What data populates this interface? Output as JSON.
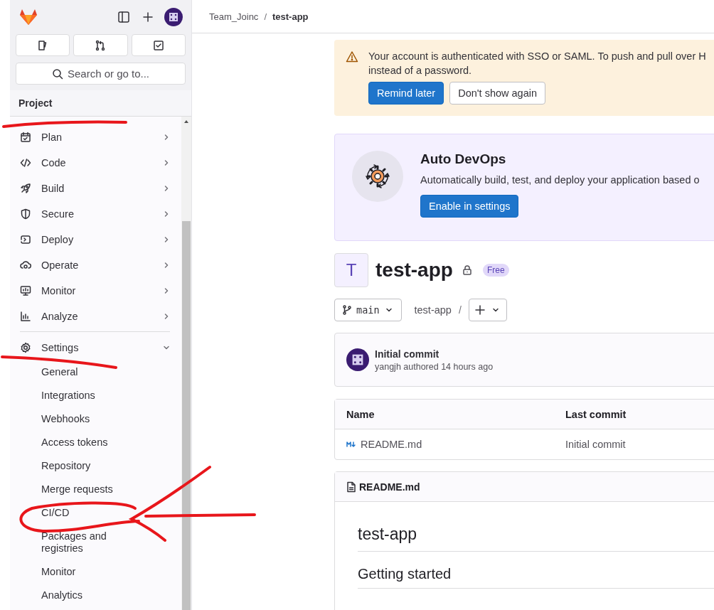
{
  "sidebar": {
    "search": {
      "placeholder": "Search or go to..."
    },
    "section": "Project",
    "items": [
      {
        "label": "Plan",
        "expanded": false
      },
      {
        "label": "Code",
        "expanded": false
      },
      {
        "label": "Build",
        "expanded": false
      },
      {
        "label": "Secure",
        "expanded": false
      },
      {
        "label": "Deploy",
        "expanded": false
      },
      {
        "label": "Operate",
        "expanded": false
      },
      {
        "label": "Monitor",
        "expanded": false
      },
      {
        "label": "Analyze",
        "expanded": false
      },
      {
        "label": "Settings",
        "expanded": true,
        "children": [
          {
            "label": "General",
            "selected": false
          },
          {
            "label": "Integrations",
            "selected": false
          },
          {
            "label": "Webhooks",
            "selected": false
          },
          {
            "label": "Access tokens",
            "selected": false
          },
          {
            "label": "Repository",
            "selected": false
          },
          {
            "label": "Merge requests",
            "selected": false
          },
          {
            "label": "CI/CD",
            "selected": false
          },
          {
            "label": "Packages and registries",
            "selected": false
          },
          {
            "label": "Monitor",
            "selected": false
          },
          {
            "label": "Analytics",
            "selected": false
          }
        ]
      }
    ]
  },
  "breadcrumb": {
    "items": [
      "Team_Joinc",
      "test-app"
    ],
    "separator": "/"
  },
  "alert": {
    "lines": [
      "Your account is authenticated with SSO or SAML. To push and pull over H",
      "instead of a password."
    ],
    "buttons": [
      {
        "label": "Remind later",
        "kind": "primary"
      },
      {
        "label": "Don't show again",
        "kind": "default"
      }
    ]
  },
  "auto_devops": {
    "title": "Auto DevOps",
    "text": "Automatically build, test, and deploy your application based o",
    "button": "Enable in settings"
  },
  "project": {
    "avatar_letter": "T",
    "name": "test-app",
    "badge": "Free"
  },
  "repo_bar": {
    "branch": "main",
    "path": "test-app",
    "separator": "/"
  },
  "commit": {
    "title": "Initial commit",
    "meta": "yangjh authored 14 hours ago"
  },
  "table": {
    "columns": [
      "Name",
      "Last commit"
    ],
    "rows": [
      {
        "name": "README.md",
        "last_commit": "Initial commit"
      }
    ]
  },
  "readme": {
    "file": "README.md",
    "headings": [
      "test-app",
      "Getting started"
    ]
  }
}
